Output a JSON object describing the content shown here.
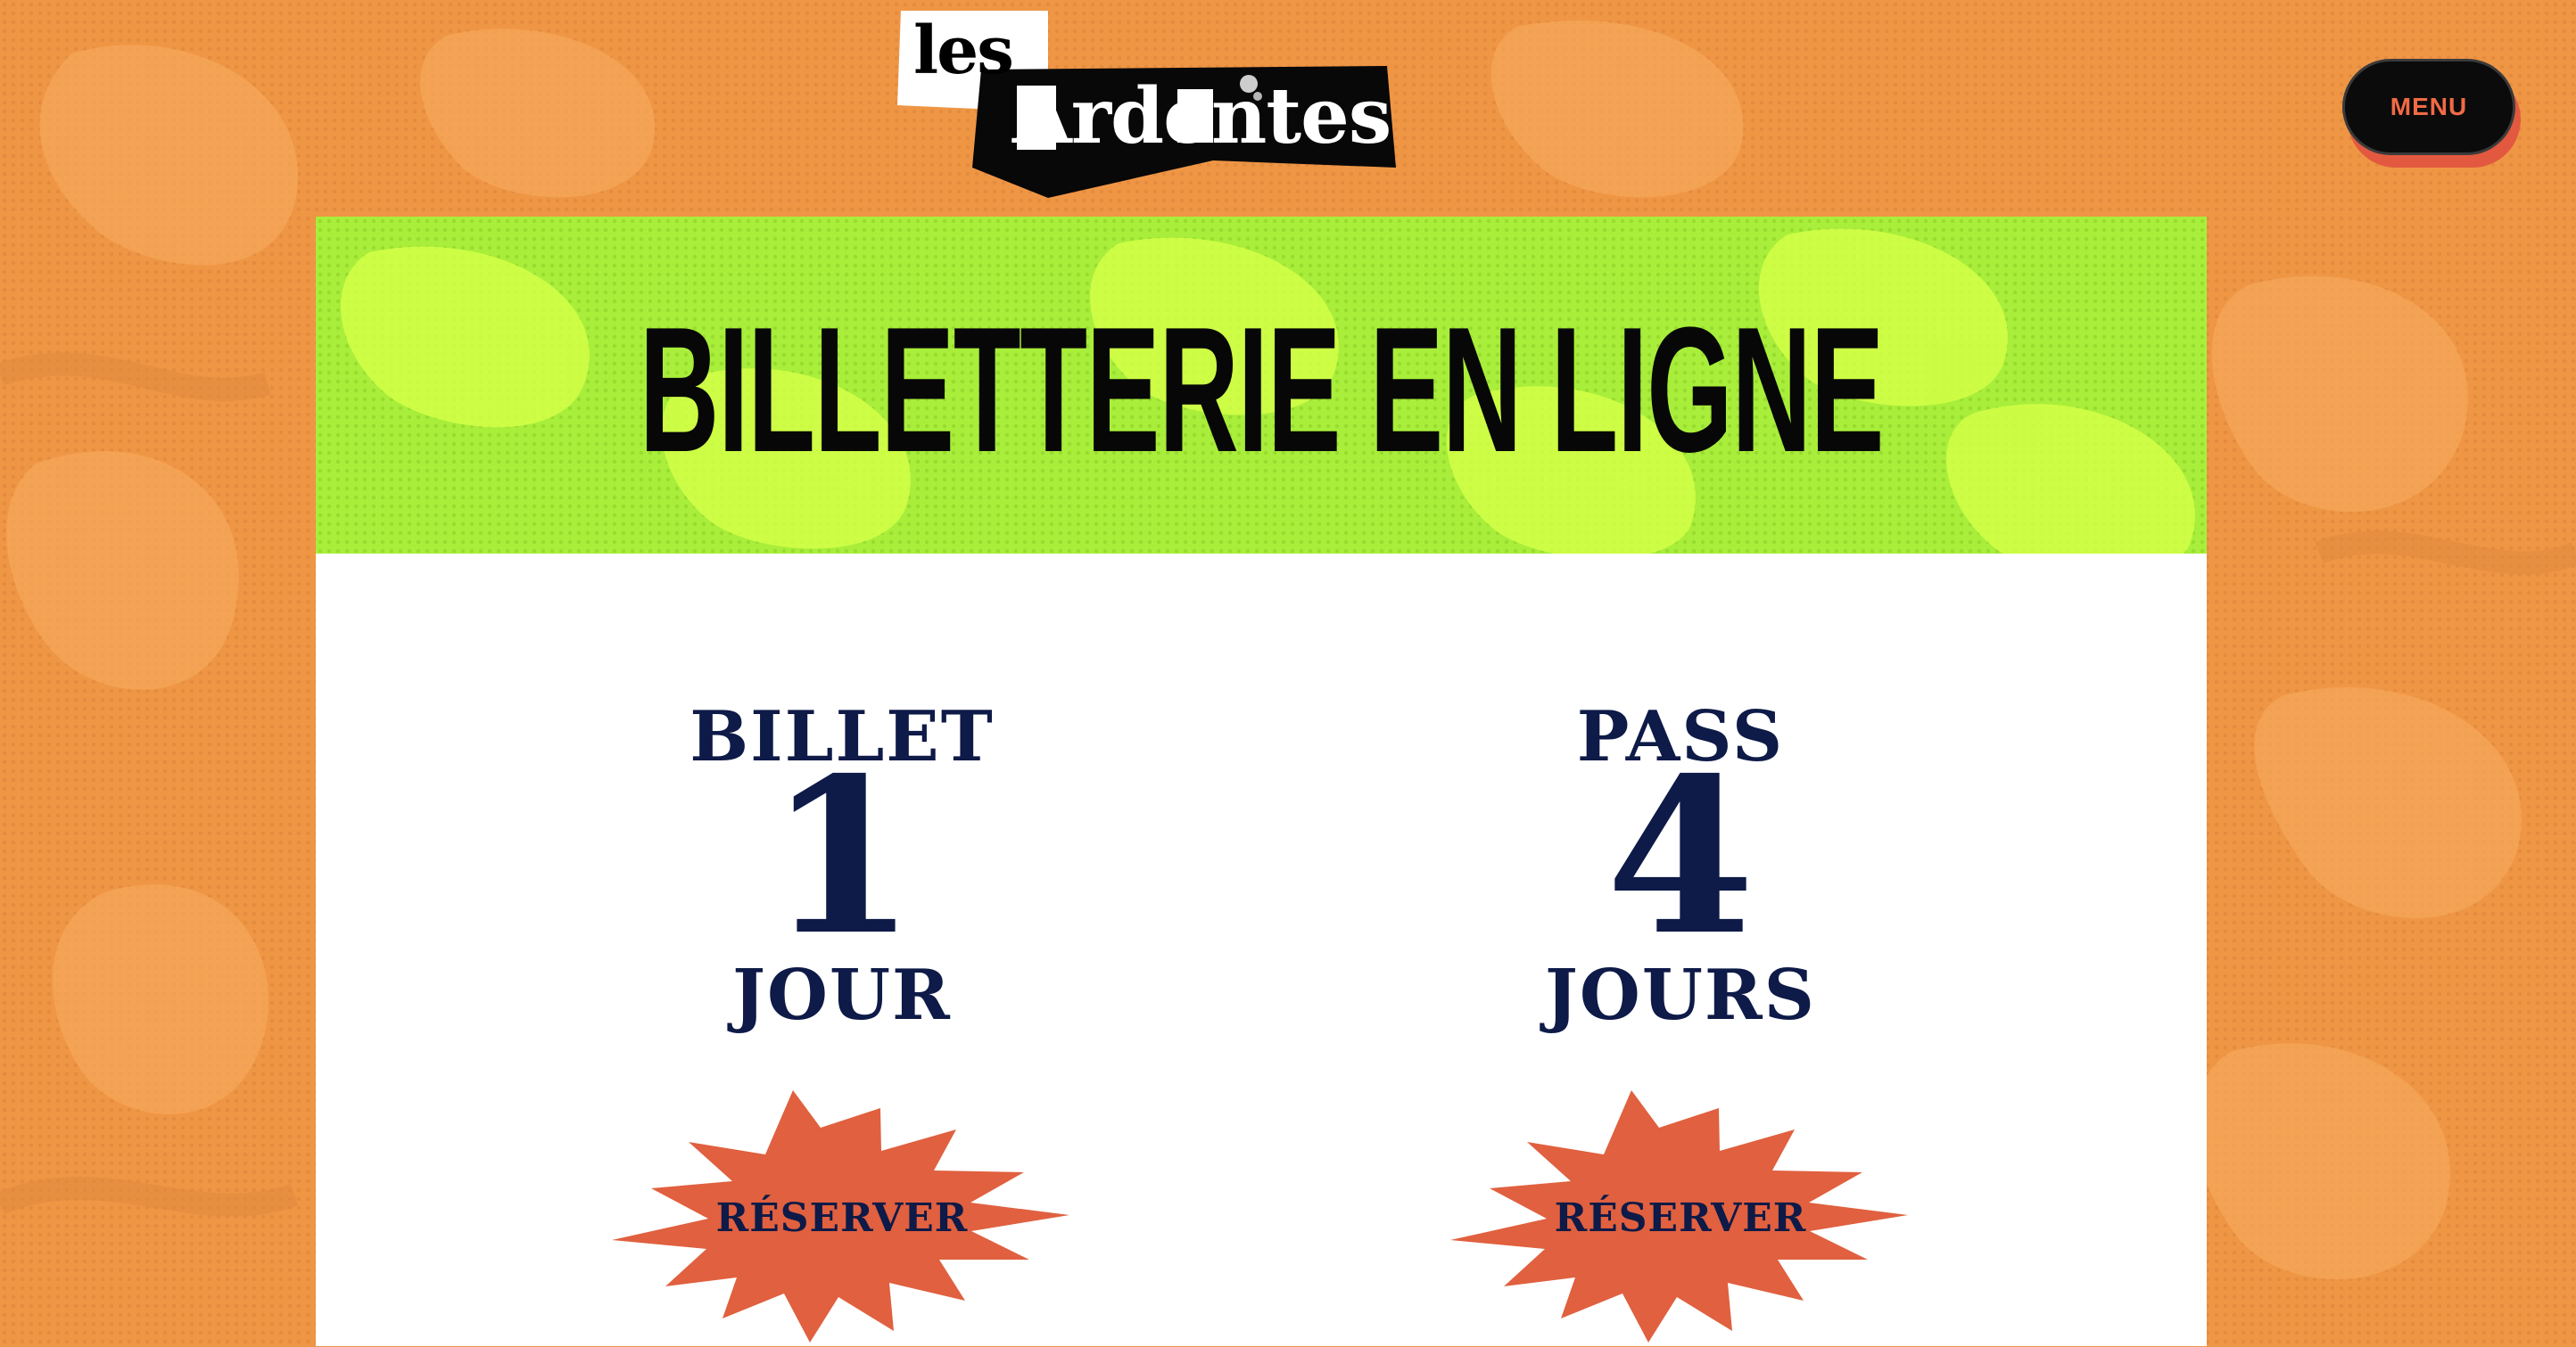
{
  "brand": {
    "logo_top": "les",
    "logo_bottom": "Ardentes"
  },
  "header": {
    "menu_label": "MENU"
  },
  "page": {
    "title": "BILLETTERIE EN LIGNE"
  },
  "tickets": [
    {
      "top": "BILLET",
      "number": "1",
      "bottom": "JOUR",
      "button_label": "RÉSERVER"
    },
    {
      "top": "PASS",
      "number": "4",
      "bottom": "JOURS",
      "button_label": "RÉSERVER"
    }
  ],
  "colors": {
    "background": "#ef9645",
    "header_band": "#a8ee3a",
    "text_navy": "#0e1a47",
    "burst": "#e0603f",
    "menu_button": "#0b0b0b",
    "menu_text": "#f06a45"
  },
  "icons": {
    "reserve_shape": "starburst-icon"
  }
}
